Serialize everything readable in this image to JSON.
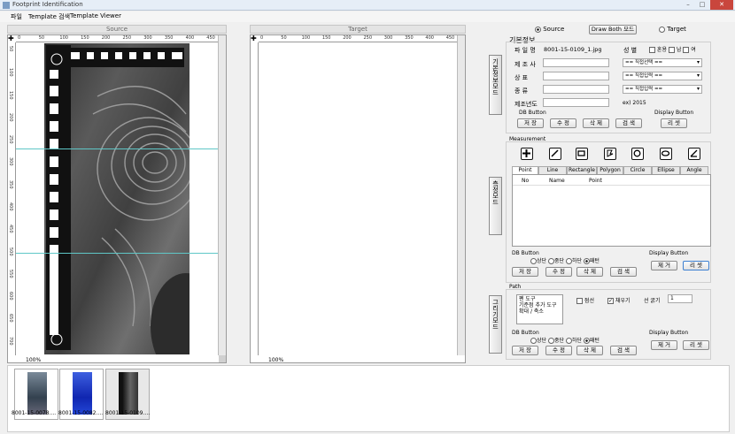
{
  "window": {
    "title": "Footprint Identification"
  },
  "menu": [
    "파일",
    "Template 검색",
    "Template Viewer"
  ],
  "source": {
    "header": "Source",
    "zoom": "100%",
    "ruler_top": [
      "0",
      "50",
      "100",
      "150",
      "200",
      "250",
      "300",
      "350",
      "400",
      "450"
    ],
    "ruler_left": [
      "50",
      "100",
      "150",
      "200",
      "250",
      "300",
      "350",
      "400",
      "450",
      "500",
      "550",
      "600",
      "650",
      "700"
    ]
  },
  "target": {
    "header": "Target",
    "zoom": "100%",
    "ruler_top": [
      "0",
      "50",
      "100",
      "150",
      "200",
      "250",
      "300",
      "350",
      "400",
      "450"
    ]
  },
  "mode": {
    "source_label": "Source",
    "target_label": "Target",
    "draw_both": "Draw Both 모드"
  },
  "basic": {
    "tab": "기본정보모드",
    "section": "기본정보",
    "file_label": "파 일 명",
    "file_value": "8001-15-0109_1.jpg",
    "gender_label": "성  별",
    "gender_opts": [
      "혼용",
      "남",
      "여"
    ],
    "maker_label": "제 조 사",
    "brand_label": "상   표",
    "kind_label": "종   류",
    "year_label": "제조년도",
    "year_hint": "ex) 2015",
    "maker_sel": "== 직접선택 ==",
    "brand_sel": "== 직접입력 ==",
    "kind_sel": "== 직접입력 ==",
    "db_label": "DB Button",
    "save": "저 장",
    "edit": "수 정",
    "del": "삭 제",
    "search": "검 색",
    "display_label": "Display Button",
    "reset": "리 셋"
  },
  "measure": {
    "tab": "측정모드",
    "section": "Measurement",
    "tabs": [
      "Point",
      "Line",
      "Rectangle",
      "Polygon",
      "Circle",
      "Ellipse",
      "Angle"
    ],
    "cols": [
      "No",
      "Name",
      "Point"
    ],
    "db_label": "DB Button",
    "opts": [
      "상단",
      "중단",
      "하단",
      "패턴"
    ],
    "save": "저 장",
    "edit": "수 정",
    "del": "삭 제",
    "search": "검 색",
    "display_label": "Display Button",
    "clear": "제 거",
    "reset": "리 셋"
  },
  "path": {
    "tab": "그리기모드",
    "section": "Path",
    "list": [
      "펜 도구",
      "기준점 추가 도구",
      "확대 / 축소"
    ],
    "dotted": "점선",
    "fill": "채우기",
    "thick_label": "선 굵기",
    "thick_value": "1",
    "db_label": "DB Button",
    "opts": [
      "상단",
      "중단",
      "하단",
      "패턴"
    ],
    "save": "저 장",
    "edit": "수 정",
    "del": "삭 제",
    "search": "검 색",
    "display_label": "Display Button",
    "clear": "제 거",
    "reset": "리 셋"
  },
  "thumbs": [
    "8001-15-0078....",
    "8001-15-0082....",
    "8001-15-0109...."
  ],
  "colors": {
    "accent": "#3c7fd0",
    "guide": "#5fc7c7"
  }
}
